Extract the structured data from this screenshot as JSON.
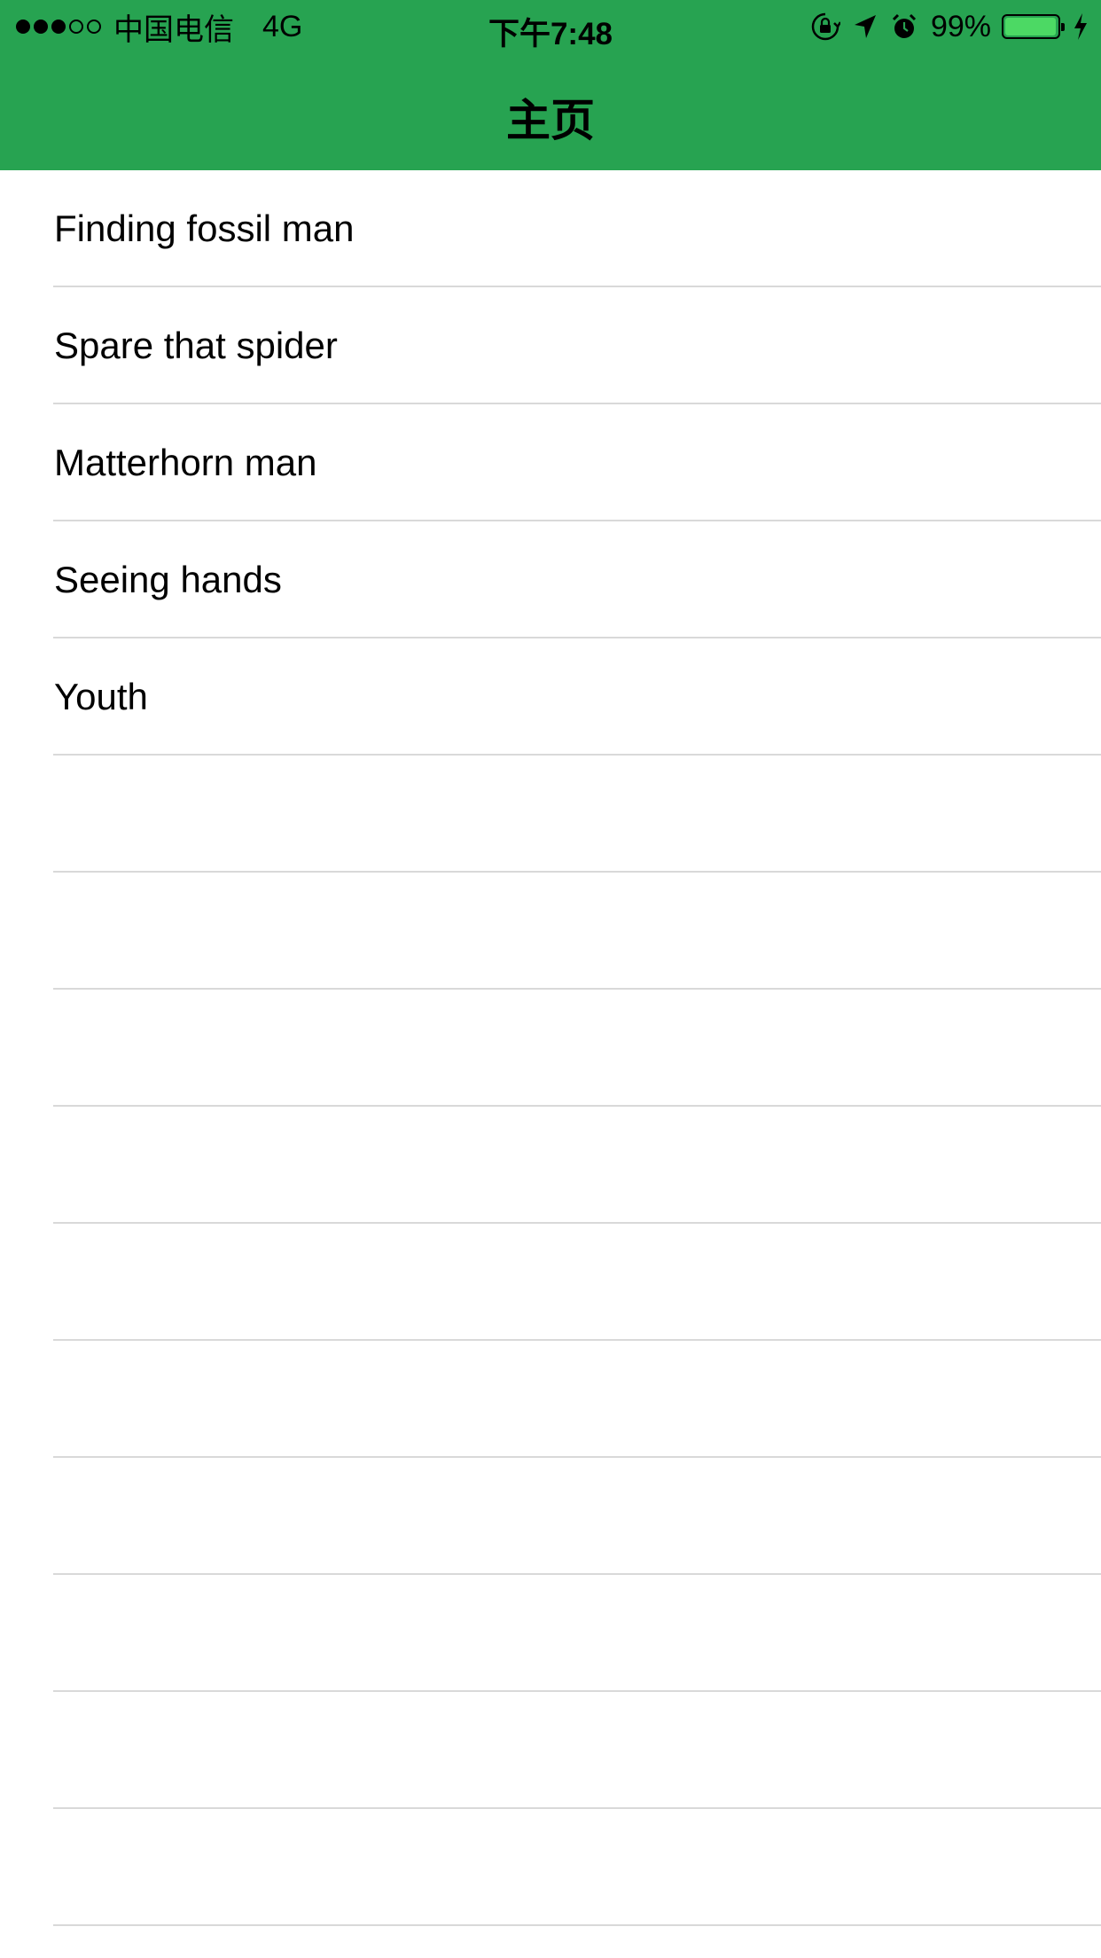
{
  "status_bar": {
    "signal": {
      "filled": 3,
      "total": 5
    },
    "carrier": "中国电信",
    "network": "4G",
    "time": "下午7:48",
    "icons": [
      "orientation-lock-icon",
      "location-arrow-icon",
      "alarm-icon"
    ],
    "battery_percent": "99%",
    "battery_level": 0.99,
    "battery_color": "#4cd964",
    "charging_icon": "charging-bolt-icon"
  },
  "nav": {
    "title": "主页",
    "background_color": "#27a351"
  },
  "list": {
    "items": [
      {
        "label": "Finding fossil man"
      },
      {
        "label": "Spare that spider"
      },
      {
        "label": "Matterhorn man"
      },
      {
        "label": "Seeing hands"
      },
      {
        "label": "Youth"
      },
      {
        "label": ""
      },
      {
        "label": ""
      },
      {
        "label": ""
      },
      {
        "label": ""
      },
      {
        "label": ""
      },
      {
        "label": ""
      },
      {
        "label": ""
      },
      {
        "label": ""
      },
      {
        "label": ""
      },
      {
        "label": ""
      },
      {
        "label": ""
      }
    ]
  }
}
